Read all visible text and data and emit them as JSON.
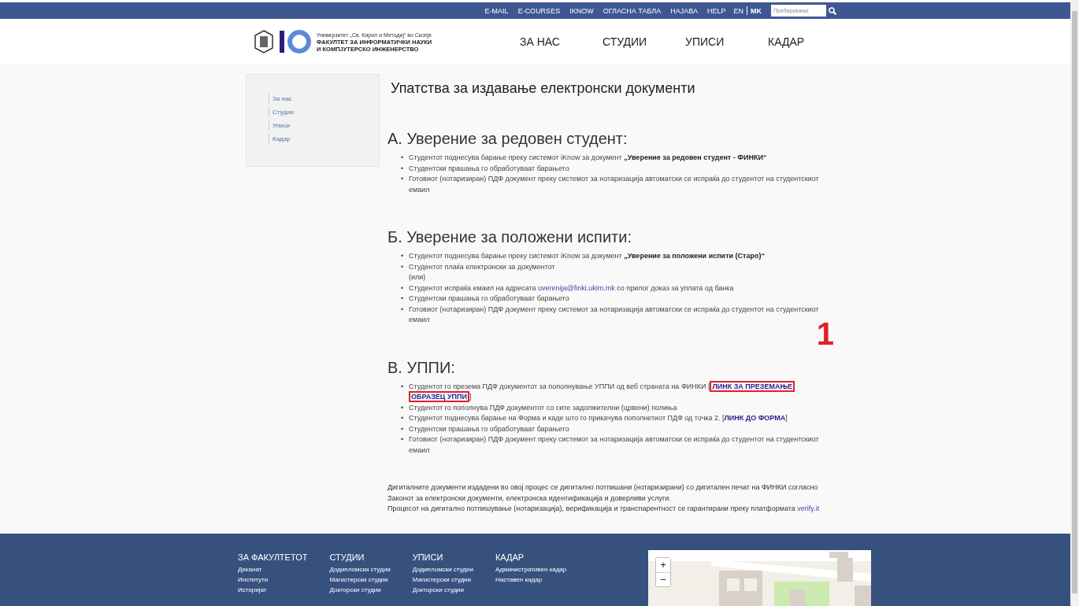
{
  "top_bar": {
    "links": [
      "E-MAIL",
      "E-COURSES",
      "IKNOW",
      "ОГЛАСНА ТАБЛА",
      "НАЈАВА",
      "HELP"
    ],
    "languages": [
      {
        "label": "EN",
        "selected": false
      },
      {
        "label": "MK",
        "selected": true
      }
    ],
    "search": {
      "placeholder": "Пребарување"
    }
  },
  "header": {
    "logo": {
      "university": "Универзитет „Св. Кирил и Методиј“ во Скопје",
      "faculty_line_1": "ФАКУЛТЕТ ЗА ИНФОРМАТИЧКИ НАУКИ",
      "faculty_line_2": "И КОМПЈУТЕРСКО ИНЖЕНЕРСТВО"
    },
    "nav": [
      "ЗА НАС",
      "СТУДИИ",
      "УПИСИ",
      "КАДАР"
    ]
  },
  "sidebar": {
    "items": [
      "За нас",
      "Студии",
      "Уписи",
      "Кадар"
    ]
  },
  "page_title": "Упатства за издавање електронски документи",
  "sections": [
    {
      "heading": "А. Уверение за редовен студент:",
      "marker": "•",
      "items": [
        {
          "segments": [
            {
              "kind": "plain",
              "text": "Студентот поднесува барање преку системот iKnow за документ "
            },
            {
              "kind": "bold",
              "text": "„Уверение за редовен студент - ФИНКИ“"
            }
          ]
        },
        {
          "segments": [
            {
              "kind": "plain",
              "text": "Студентски прашања го обработуваат барањето"
            }
          ]
        },
        {
          "segments": [
            {
              "kind": "plain",
              "text": "Готовиот (нотаризиран) ПДФ документ преку системот за нотаризација автоматски се испраќа до студентот на студентскиот емаил"
            }
          ]
        }
      ]
    },
    {
      "heading": "Б. Уверение за положени испити:",
      "marker": "•",
      "items": [
        {
          "segments": [
            {
              "kind": "plain",
              "text": "Студентот поднесува барање преку системот iKnow за документ "
            },
            {
              "kind": "bold",
              "text": "„Уверение за положени испити (Старо)“"
            }
          ]
        },
        {
          "segments": [
            {
              "kind": "plain",
              "text": "Студентот плаќа електронски за документот"
            }
          ],
          "note": "(или)"
        },
        {
          "segments": [
            {
              "kind": "plain",
              "text": "Студентот испраќа емаил на адресата "
            },
            {
              "kind": "link",
              "text": "uverenija@finki.ukim.mk"
            },
            {
              "kind": "plain",
              "text": " со прилог доказ за уплата од банка"
            }
          ]
        },
        {
          "segments": [
            {
              "kind": "plain",
              "text": "Студентски прашања го обработуваат барањето"
            }
          ]
        },
        {
          "segments": [
            {
              "kind": "plain",
              "text": "Готовиот (нотаризиран) ПДФ документ преку системот за нотаризација автоматски се испраќа до студентот на студентскиот емаил"
            }
          ]
        }
      ]
    },
    {
      "heading": "В. УППИ:",
      "marker": "•",
      "items": [
        {
          "segments": [
            {
              "kind": "plain",
              "text": "Студентот го презема ПДФ документот за пополнување УППИ од веб страната на ФИНКИ ["
            },
            {
              "kind": "bold-link",
              "text": "ЛИНК ЗА ПРЕЗЕМАЊЕ",
              "highlighted": true
            },
            {
              "kind": "break"
            },
            {
              "kind": "bold-link",
              "text": "ОБРАЗЕЦ УППИ",
              "highlighted": true
            },
            {
              "kind": "plain",
              "text": "]"
            }
          ]
        },
        {
          "segments": [
            {
              "kind": "plain",
              "text": "Студентот го пополнува ПДФ документот со сите задолжителни (црвени) полиња"
            }
          ]
        },
        {
          "segments": [
            {
              "kind": "plain",
              "text": "Студентот поднесува барање на Форма и каде што го прикачува пополнетиот ПДФ од точка 2. ["
            },
            {
              "kind": "bold-link",
              "text": "ЛИНК ДО ФОРМА"
            },
            {
              "kind": "plain",
              "text": "]"
            }
          ]
        },
        {
          "segments": [
            {
              "kind": "plain",
              "text": "Студентски прашања го обработуваат барањето"
            }
          ]
        },
        {
          "segments": [
            {
              "kind": "plain",
              "text": "Готовиот (нотаризиран) ПДФ документ преку системот за нотаризација автоматски се испраќа до студентот на студентскиот емаил"
            }
          ]
        }
      ]
    }
  ],
  "annotation": "1",
  "closing": [
    {
      "text": "Дигиталните документи издадени во овој процес се дигитално потпишани (нотаризирани) со дигитален печат на ФИНКИ согласно Законот за електронски документи, електронска идентификација и доверливи услуги."
    },
    {
      "text": "Процесот на дигитално потпишување (нотаризација), верификација и транспарентност се гарантирани преку платформата ",
      "link": "verify.it"
    }
  ],
  "footer": {
    "columns": [
      {
        "title": "ЗА ФАКУЛТЕТОТ",
        "links": [
          "Деканат",
          "Институти",
          "Историјат"
        ]
      },
      {
        "title": "СТУДИИ",
        "links": [
          "Додипломски студии",
          "Магистерски студии",
          "Докторски студии"
        ]
      },
      {
        "title": "УПИСИ",
        "links": [
          "Додипломски студии",
          "Магистерски студии",
          "Докторски студии"
        ]
      },
      {
        "title": "КАДАР",
        "links": [
          "Административен кадар",
          "Наставен кадар"
        ]
      }
    ],
    "map": {
      "kind": "picture",
      "zoom_in": "+",
      "zoom_out": "−"
    }
  }
}
